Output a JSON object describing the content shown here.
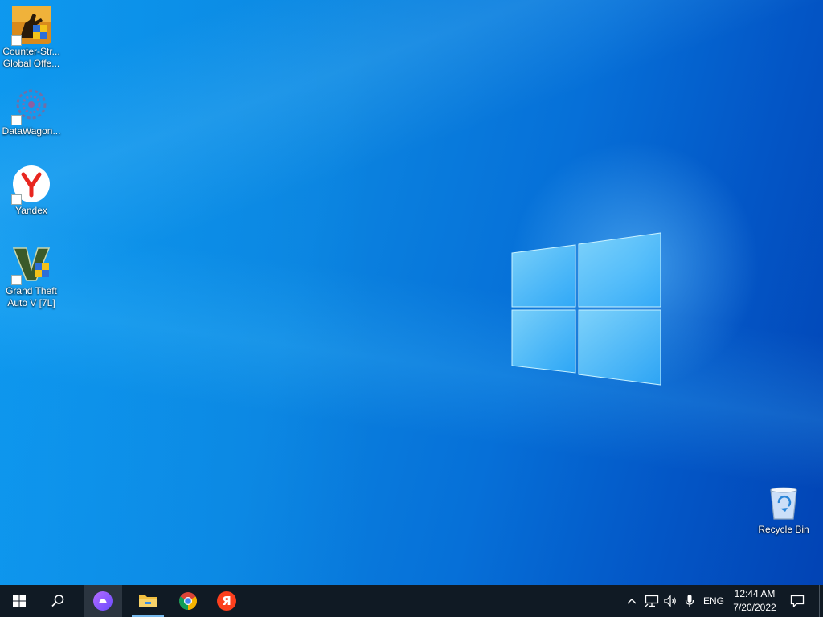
{
  "desktop": {
    "icons": [
      {
        "label_line1": "Counter-Str...",
        "label_line2": "Global Offe...",
        "icon": "counter-strike-icon"
      },
      {
        "label_line1": "DataWagon...",
        "icon": "datawagon-icon"
      },
      {
        "label_line1": "Yandex",
        "icon": "yandex-browser-icon"
      },
      {
        "label_line1": "Grand Theft",
        "label_line2": "Auto V [7L]",
        "icon": "gta-v-icon"
      }
    ],
    "recycle_bin": {
      "label": "Recycle Bin",
      "icon": "recycle-bin-icon"
    }
  },
  "taskbar": {
    "pinned": [
      {
        "name": "start",
        "icon": "windows-start-icon"
      },
      {
        "name": "search",
        "icon": "search-icon"
      },
      {
        "name": "alice",
        "icon": "alice-assistant-icon"
      },
      {
        "name": "file-explorer",
        "icon": "folder-icon"
      },
      {
        "name": "chrome",
        "icon": "chrome-icon"
      },
      {
        "name": "yandex",
        "icon": "yandex-icon",
        "glyph": "Я"
      }
    ],
    "tray": {
      "language": "ENG",
      "time": "12:44 AM",
      "date": "7/20/2022"
    }
  },
  "colors": {
    "taskbar_bg": "#101a24",
    "desktop_accent": "#0a8fe6",
    "yandex_red": "#f33",
    "alice_purple": "#8c5cff"
  }
}
